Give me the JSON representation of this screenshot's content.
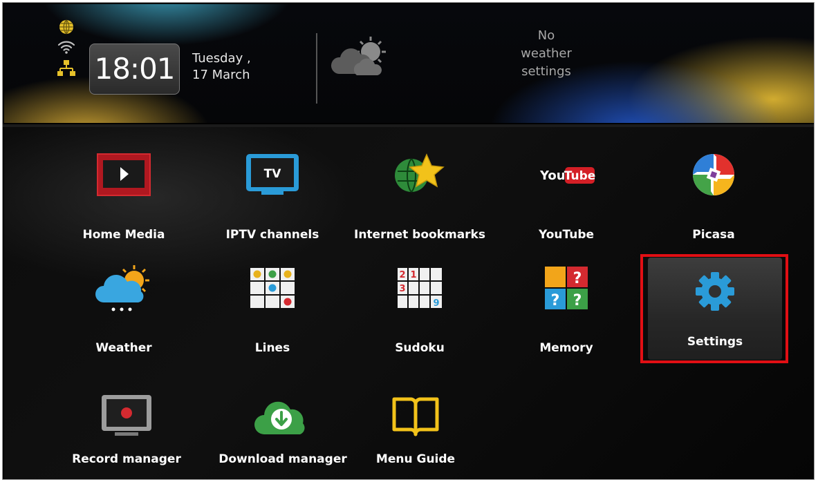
{
  "header": {
    "time": "18:01",
    "day": "Tuesday ,",
    "date": "17 March",
    "weather_text": "No\nweather\nsettings",
    "status_icons": [
      "globe-icon",
      "wifi-icon",
      "network-icon"
    ]
  },
  "menu": {
    "items": [
      {
        "label": "Home Media",
        "icon": "home-media-icon"
      },
      {
        "label": "IPTV channels",
        "icon": "tv-icon"
      },
      {
        "label": "Internet bookmarks",
        "icon": "bookmark-star-icon"
      },
      {
        "label": "YouTube",
        "icon": "youtube-icon"
      },
      {
        "label": "Picasa",
        "icon": "picasa-icon"
      },
      {
        "label": "Weather",
        "icon": "weather-icon"
      },
      {
        "label": "Lines",
        "icon": "lines-game-icon"
      },
      {
        "label": "Sudoku",
        "icon": "sudoku-icon"
      },
      {
        "label": "Memory",
        "icon": "memory-game-icon"
      },
      {
        "label": "Settings",
        "icon": "gear-icon",
        "selected": true
      },
      {
        "label": "Record manager",
        "icon": "record-icon"
      },
      {
        "label": "Download manager",
        "icon": "download-cloud-icon"
      },
      {
        "label": "Menu Guide",
        "icon": "book-icon"
      }
    ],
    "youtube_logo": {
      "you": "You",
      "tube": "Tube"
    },
    "tv_logo": "TV",
    "sudoku_digits": [
      "2",
      "1",
      "3",
      "9"
    ],
    "memory_marks": [
      "?",
      "?",
      "?"
    ]
  },
  "colors": {
    "selection": "#e10f14",
    "accent_blue": "#2a9bd8"
  }
}
